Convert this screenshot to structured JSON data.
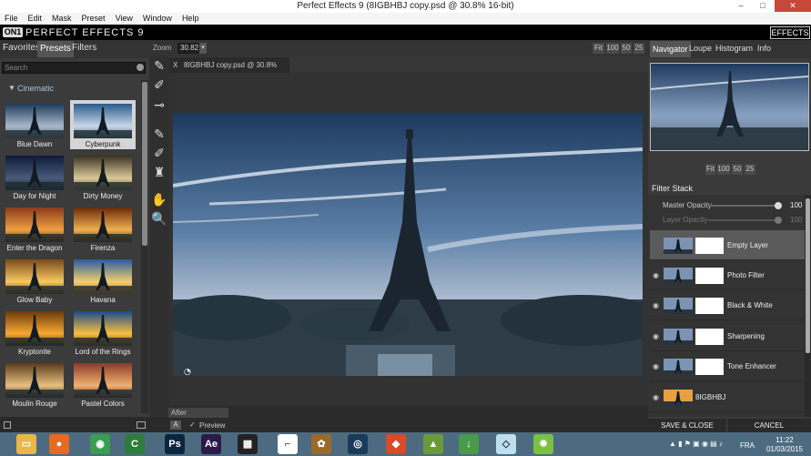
{
  "window": {
    "title": "Perfect Effects 9 (8IGBHBJ copy.psd @ 30.8% 16-bit)",
    "minimize": "–",
    "maximize": "□",
    "close": "✕"
  },
  "menu": [
    "File",
    "Edit",
    "Mask",
    "Preset",
    "View",
    "Window",
    "Help"
  ],
  "app": {
    "logo": "ON1",
    "name": "PERFECT EFFECTS 9",
    "effects_button": "EFFECTS"
  },
  "left_panel": {
    "tabs": [
      "Favorites",
      "Presets",
      "Filters"
    ],
    "active_tab": "Presets",
    "search_placeholder": "Search",
    "category": "Cinematic",
    "presets": [
      {
        "label": "Blue Dawn",
        "selected": false
      },
      {
        "label": "Cyberpunk",
        "selected": true
      },
      {
        "label": "Day for Night",
        "selected": false
      },
      {
        "label": "Dirty Money",
        "selected": false
      },
      {
        "label": "Enter the Dragon",
        "selected": false
      },
      {
        "label": "Firenza",
        "selected": false
      },
      {
        "label": "Glow Baby",
        "selected": false
      },
      {
        "label": "Havana",
        "selected": false
      },
      {
        "label": "Kryptonite",
        "selected": false
      },
      {
        "label": "Lord of the Rings",
        "selected": false
      },
      {
        "label": "Moulin Rouge",
        "selected": false
      },
      {
        "label": "Pastel Colors",
        "selected": false
      }
    ]
  },
  "zoom": {
    "label": "Zoom",
    "value": "30.82",
    "buttons": [
      "Fit",
      "100",
      "50",
      "25"
    ]
  },
  "document": {
    "close": "X",
    "tab_name": "8IGBHBJ copy.psd @ 30.8% 16-bit"
  },
  "canvas_footer": {
    "view_mode": "After",
    "compare_button": "A",
    "preview_check": "✓",
    "preview_label": "Preview"
  },
  "right_panel": {
    "tabs": [
      "Navigator",
      "Loupe",
      "Histogram",
      "Info"
    ],
    "active_tab": "Navigator",
    "nav_buttons": [
      "Fit",
      "100",
      "50",
      "25"
    ],
    "filter_stack_title": "Filter Stack",
    "master_opacity_label": "Master Opacity",
    "master_opacity_value": "100",
    "layer_opacity_label": "Layer Opacity",
    "layer_opacity_value": "100",
    "layers": [
      {
        "name": "Empty Layer",
        "selected": true,
        "eye": false,
        "mask": true
      },
      {
        "name": "Photo Filter",
        "selected": false,
        "eye": true,
        "mask": true
      },
      {
        "name": "Black & White",
        "selected": false,
        "eye": true,
        "mask": true
      },
      {
        "name": "Sharpening",
        "selected": false,
        "eye": true,
        "mask": true
      },
      {
        "name": "Tone Enhancer",
        "selected": false,
        "eye": true,
        "mask": true
      },
      {
        "name": "8IGBHBJ",
        "selected": false,
        "eye": true,
        "mask": false
      }
    ],
    "save_button": "SAVE & CLOSE",
    "cancel_button": "CANCEL"
  },
  "taskbar": {
    "apps": [
      {
        "name": "file-explorer-icon",
        "glyph": "▭",
        "color": "#e8b84a"
      },
      {
        "name": "firefox-icon",
        "glyph": "●",
        "color": "#e66a1f"
      },
      {
        "name": "chrome-icon",
        "glyph": "◉",
        "color": "#3a9d4f"
      },
      {
        "name": "camtasia-icon",
        "glyph": "C",
        "color": "#2e7d3c"
      },
      {
        "name": "photoshop-icon",
        "glyph": "Ps",
        "color": "#0c2440"
      },
      {
        "name": "after-effects-icon",
        "glyph": "Ae",
        "color": "#2a1a4a"
      },
      {
        "name": "film-icon",
        "glyph": "▦",
        "color": "#222222"
      },
      {
        "name": "bracket-app-icon",
        "glyph": "⌐",
        "color": "#ffffff"
      },
      {
        "name": "game-app-icon",
        "glyph": "✿",
        "color": "#9a6a2a"
      },
      {
        "name": "cinema4d-icon",
        "glyph": "◎",
        "color": "#1a3a5a"
      },
      {
        "name": "flame-app-icon",
        "glyph": "◆",
        "color": "#d84a2a"
      },
      {
        "name": "android-icon",
        "glyph": "▲",
        "color": "#6a9a3a"
      },
      {
        "name": "download-icon",
        "glyph": "↓",
        "color": "#4a9a4a"
      },
      {
        "name": "notes-icon",
        "glyph": "◇",
        "color": "#bde0f0"
      },
      {
        "name": "perfect-effects-icon",
        "glyph": "✹",
        "color": "#7ac043"
      }
    ],
    "tray_icons": "▲ ▮ ⚑ ▣ ◉ ▤ ♪",
    "language": "FRA",
    "time": "11:22",
    "date": "01/03/2015"
  }
}
